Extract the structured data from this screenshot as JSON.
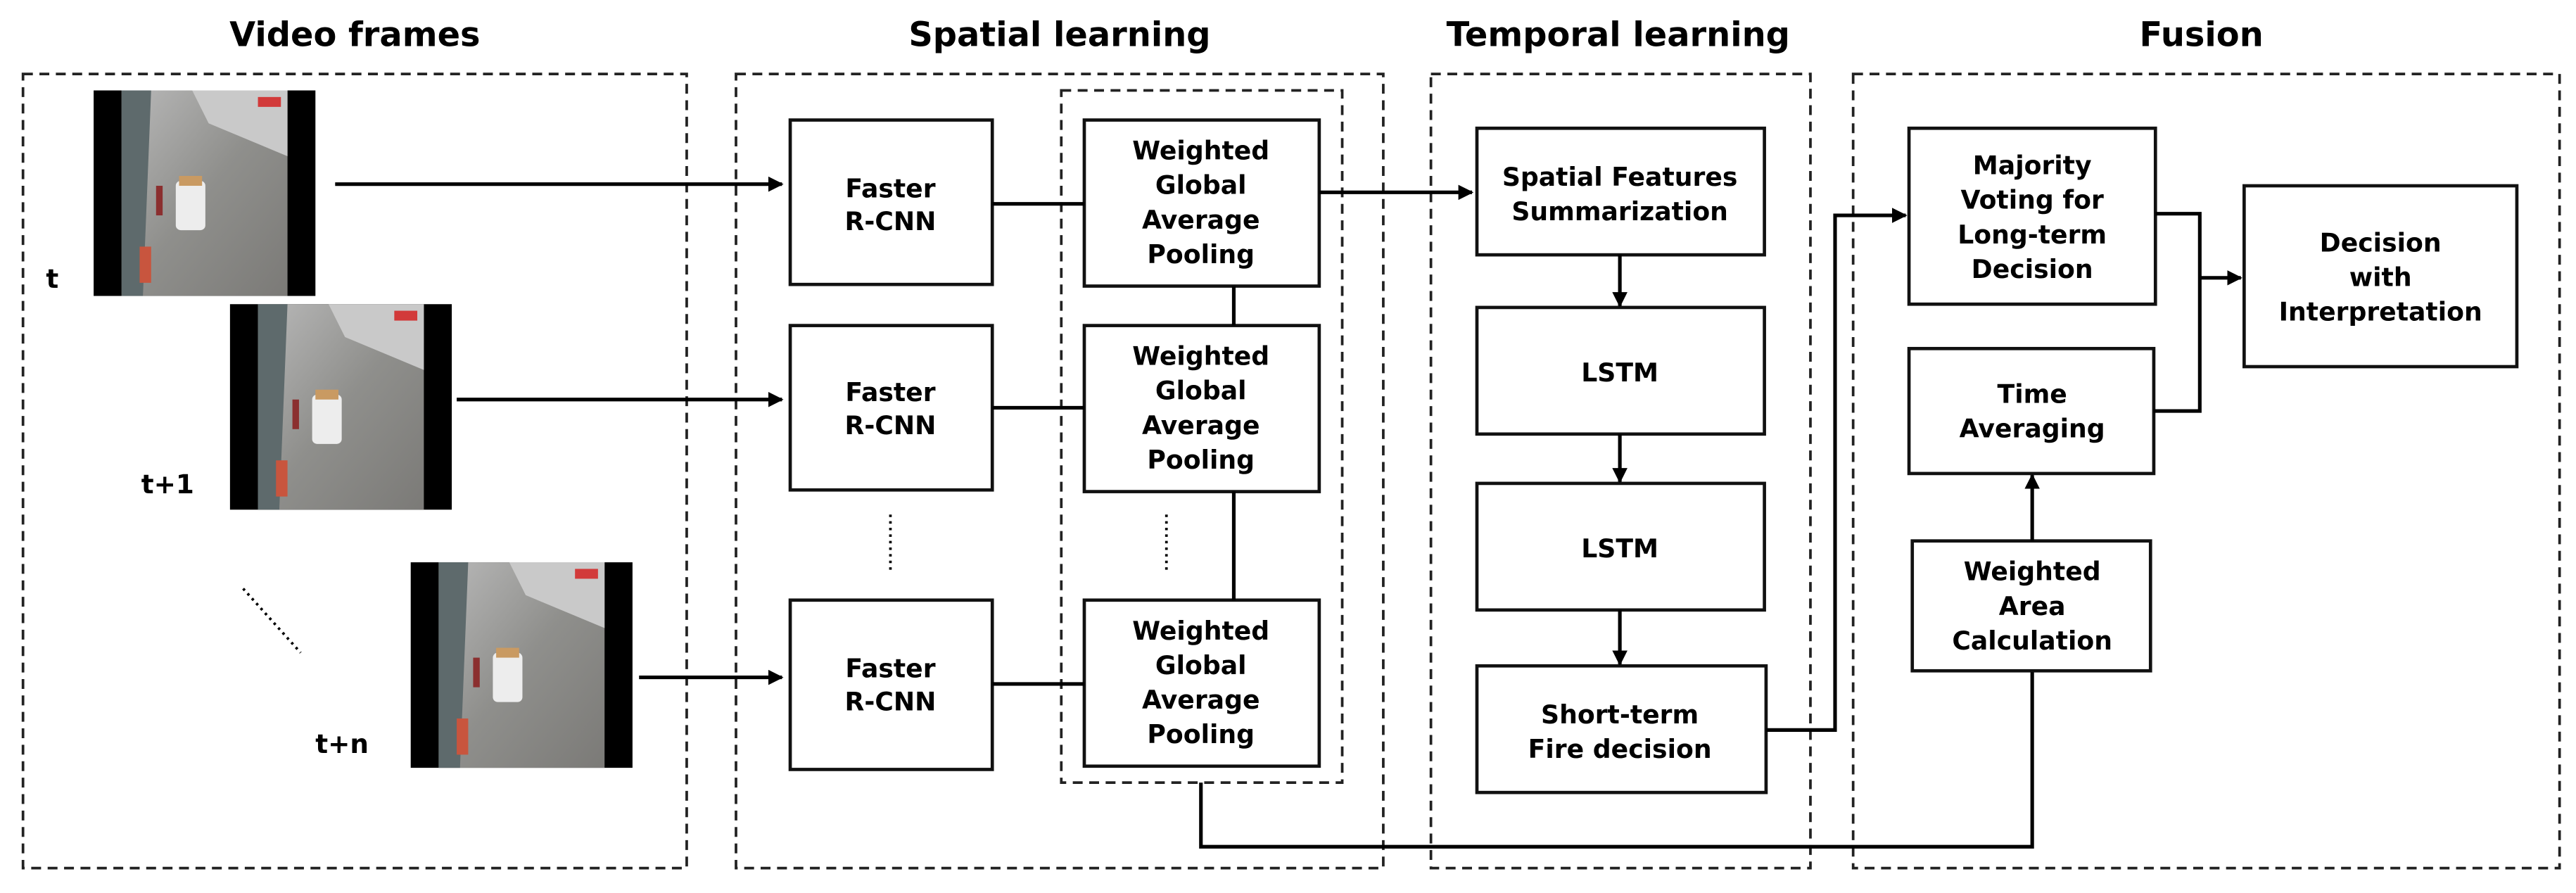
{
  "sections": {
    "video_frames": {
      "title": "Video frames"
    },
    "spatial": {
      "title": "Spatial learning"
    },
    "temporal": {
      "title": "Temporal learning"
    },
    "fusion": {
      "title": "Fusion"
    }
  },
  "frames": [
    {
      "label": "t",
      "icon": "cctv-frame-image"
    },
    {
      "label": "t+1",
      "icon": "cctv-frame-image"
    },
    {
      "label": "t+n",
      "icon": "cctv-frame-image"
    }
  ],
  "spatial_nodes": {
    "detector": [
      "Faster",
      "R-CNN"
    ],
    "pooling": [
      "Weighted",
      "Global",
      "Average",
      "Pooling"
    ]
  },
  "temporal_nodes": {
    "summarization": [
      "Spatial Features",
      "Summarization"
    ],
    "lstm1": [
      "LSTM"
    ],
    "lstm2": [
      "LSTM"
    ],
    "short_term": [
      "Short-term",
      "Fire decision"
    ]
  },
  "fusion_nodes": {
    "majority": [
      "Majority",
      "Voting for",
      "Long-term",
      "Decision"
    ],
    "time_avg": [
      "Time",
      "Averaging"
    ],
    "weighted_area": [
      "Weighted",
      "Area",
      "Calculation"
    ],
    "decision": [
      "Decision",
      "with",
      "Interpretation"
    ]
  },
  "colors": {
    "line": "#000000",
    "box_border": "#111111",
    "background": "#ffffff"
  }
}
